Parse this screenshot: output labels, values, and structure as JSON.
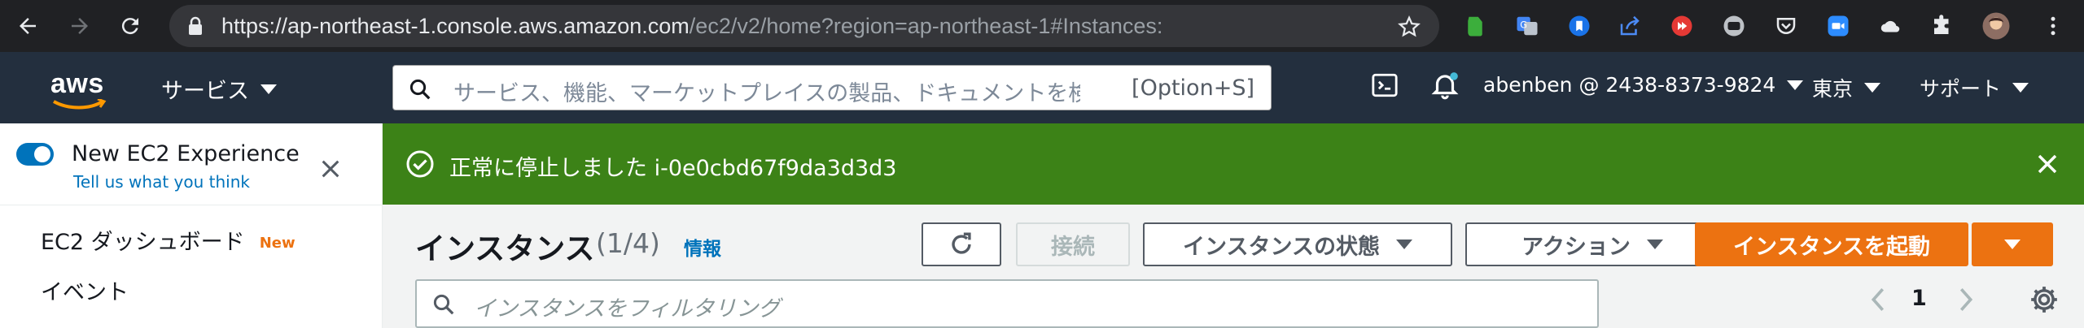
{
  "browser": {
    "url_host": "https://ap-northeast-1.console.aws.amazon.com",
    "url_path": "/ec2/v2/home?region=ap-northeast-1#Instances:"
  },
  "awsnav": {
    "logo": "aws",
    "services_label": "サービス",
    "search_placeholder": "サービス、機能、マーケットプレイスの製品、ドキュメントを検索",
    "search_shortcut": "[Option+S]",
    "account": "abenben @ 2438-8373-9824",
    "region": "東京",
    "support": "サポート"
  },
  "sidebar": {
    "new_experience": "New EC2 Experience",
    "tell_us": "Tell us what you think",
    "items": [
      {
        "label": "EC2 ダッシュボード",
        "badge": "New"
      },
      {
        "label": "イベント"
      }
    ]
  },
  "flash": {
    "message": "正常に停止しました i-0e0cbd67f9da3d3d3",
    "color": "#3c8217"
  },
  "main": {
    "title": "インスタンス",
    "count": "(1/4)",
    "info_link": "情報",
    "connect_label": "接続",
    "state_label": "インスタンスの状態",
    "actions_label": "アクション",
    "launch_label": "インスタンスを起動",
    "filter_placeholder": "インスタンスをフィルタリング",
    "page_number": "1"
  },
  "colors": {
    "accent": "#ec7211",
    "link": "#0073bb",
    "nav_bg": "#232f3e"
  }
}
